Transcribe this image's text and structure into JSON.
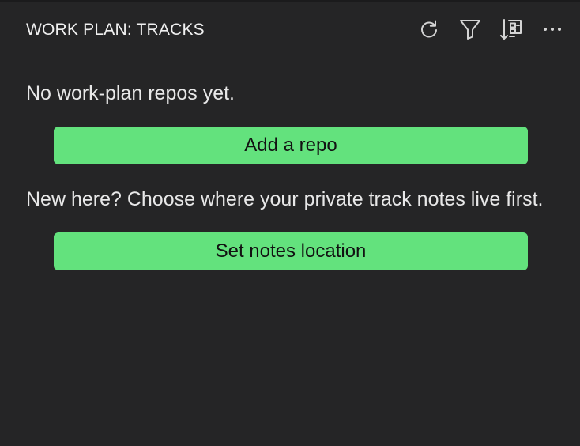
{
  "panel": {
    "title": "WORK PLAN: TRACKS"
  },
  "toolbar": {
    "actions": [
      {
        "name": "refresh",
        "icon": "refresh-icon"
      },
      {
        "name": "filter",
        "icon": "filter-icon"
      },
      {
        "name": "sort",
        "icon": "sort-icon"
      },
      {
        "name": "more",
        "icon": "more-icon"
      }
    ]
  },
  "empty_state": {
    "no_repos_message": "No work-plan repos yet.",
    "add_repo_label": "Add a repo",
    "new_here_message": "New here? Choose where your private track notes live first.",
    "set_notes_label": "Set notes location"
  },
  "colors": {
    "background": "#252526",
    "accent": "#63e27d",
    "text": "#e6e6e6"
  }
}
